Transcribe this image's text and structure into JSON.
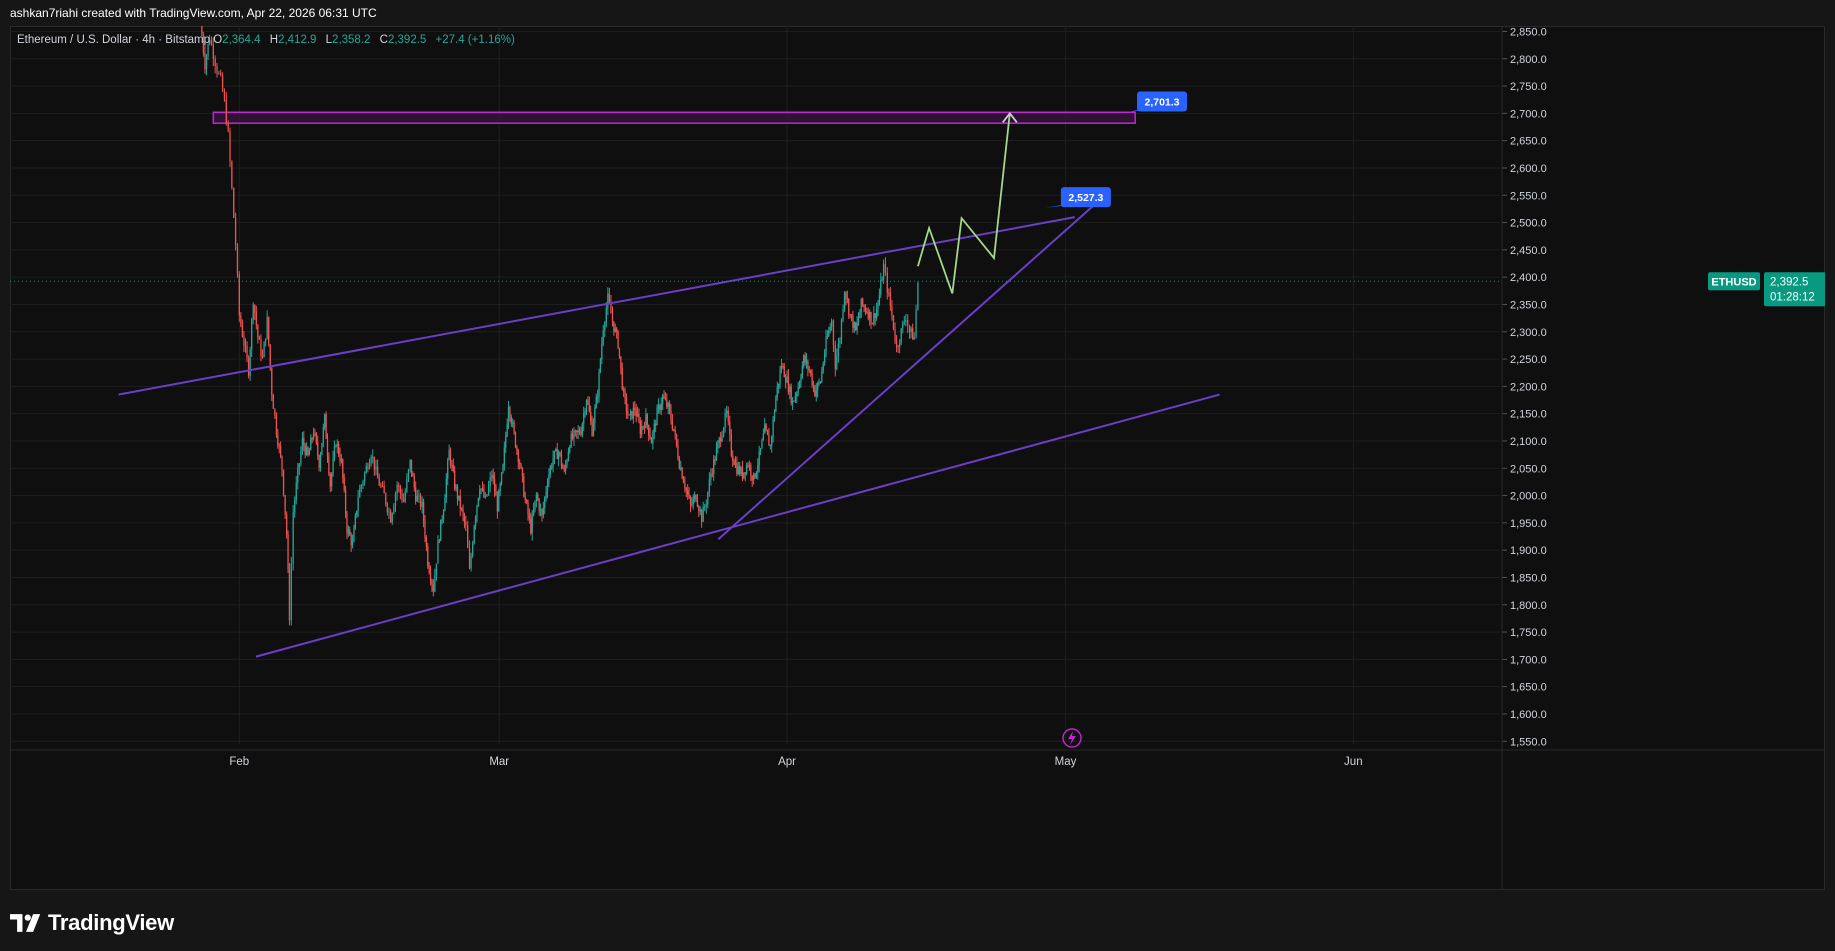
{
  "header": {
    "attribution": "ashkan7riahi created with TradingView.com, Apr 22, 2026 06:31 UTC"
  },
  "legend": {
    "name": "Ethereum / U.S. Dollar · 4h · Bitstamp",
    "o_label": "O",
    "o_value": "2,364.4",
    "h_label": "H",
    "h_value": "2,412.9",
    "l_label": "L",
    "l_value": "2,358.2",
    "c_label": "C",
    "c_value": "2,392.5",
    "change": "+27.4 (+1.16%)"
  },
  "footer": {
    "brand": "TradingView"
  },
  "colors": {
    "up": "#26a69a",
    "down": "#ef5350",
    "trendline": "#6a3fc8",
    "projection": "#a5d68a",
    "zone_border": "#c026d3",
    "zone_fill": "#3a1440",
    "callout": "#2962ff",
    "price_tag": "#089981"
  },
  "chart_data": {
    "type": "candlestick",
    "symbol": "ETHUSD",
    "timeframe": "4h",
    "y_axis": {
      "ticks": [
        "2,850.0",
        "2,800.0",
        "2,750.0",
        "2,700.0",
        "2,650.0",
        "2,600.0",
        "2,550.0",
        "2,500.0",
        "2,450.0",
        "2,400.0",
        "2,350.0",
        "2,300.0",
        "2,250.0",
        "2,200.0",
        "2,150.0",
        "2,100.0",
        "2,050.0",
        "2,000.0",
        "1,950.0",
        "1,900.0",
        "1,850.0",
        "1,800.0",
        "1,750.0",
        "1,700.0",
        "1,650.0",
        "1,600.0",
        "1,550.0"
      ],
      "ylim": [
        1545,
        2860
      ]
    },
    "x_axis": {
      "ticks": [
        {
          "label": "Feb",
          "day": 31
        },
        {
          "label": "Mar",
          "day": 59
        },
        {
          "label": "Apr",
          "day": 90
        },
        {
          "label": "May",
          "day": 120
        },
        {
          "label": "Jun",
          "day": 151
        }
      ],
      "xlim": [
        6.3,
        166.8
      ]
    },
    "last_price": {
      "symbol": "ETHUSD",
      "price": 2392.5,
      "label": "2,392.5",
      "countdown": "01:28:12"
    },
    "price_path": [
      [
        26.8,
        2870
      ],
      [
        27.3,
        2790
      ],
      [
        27.8,
        2840
      ],
      [
        28.2,
        2810
      ],
      [
        28.6,
        2780
      ],
      [
        29.0,
        2760
      ],
      [
        29.4,
        2720
      ],
      [
        29.8,
        2660
      ],
      [
        30.2,
        2560
      ],
      [
        30.6,
        2460
      ],
      [
        31.0,
        2330
      ],
      [
        31.5,
        2280
      ],
      [
        32.0,
        2230
      ],
      [
        32.5,
        2360
      ],
      [
        33.0,
        2290
      ],
      [
        33.5,
        2250
      ],
      [
        34.0,
        2320
      ],
      [
        34.5,
        2190
      ],
      [
        35.0,
        2120
      ],
      [
        35.6,
        2050
      ],
      [
        36.1,
        1930
      ],
      [
        36.4,
        1780
      ],
      [
        36.8,
        1970
      ],
      [
        37.3,
        2040
      ],
      [
        37.8,
        2100
      ],
      [
        38.4,
        2070
      ],
      [
        39.0,
        2120
      ],
      [
        39.6,
        2060
      ],
      [
        40.2,
        2140
      ],
      [
        40.8,
        2020
      ],
      [
        41.4,
        2100
      ],
      [
        42.0,
        2060
      ],
      [
        42.6,
        1940
      ],
      [
        43.2,
        1910
      ],
      [
        43.8,
        2000
      ],
      [
        44.5,
        2040
      ],
      [
        45.2,
        2080
      ],
      [
        45.9,
        2030
      ],
      [
        46.6,
        2000
      ],
      [
        47.3,
        1960
      ],
      [
        48.0,
        2020
      ],
      [
        48.7,
        1990
      ],
      [
        49.4,
        2060
      ],
      [
        50.0,
        2000
      ],
      [
        50.7,
        1980
      ],
      [
        51.3,
        1880
      ],
      [
        51.9,
        1830
      ],
      [
        52.4,
        1910
      ],
      [
        53.0,
        1980
      ],
      [
        53.6,
        2080
      ],
      [
        54.2,
        2020
      ],
      [
        54.8,
        1980
      ],
      [
        55.4,
        1940
      ],
      [
        55.8,
        1860
      ],
      [
        56.3,
        1950
      ],
      [
        56.9,
        2020
      ],
      [
        57.5,
        1990
      ],
      [
        58.2,
        2040
      ],
      [
        58.8,
        1980
      ],
      [
        59.4,
        2050
      ],
      [
        60.0,
        2170
      ],
      [
        60.6,
        2110
      ],
      [
        61.2,
        2060
      ],
      [
        61.8,
        1990
      ],
      [
        62.4,
        1940
      ],
      [
        63.0,
        2000
      ],
      [
        63.6,
        1960
      ],
      [
        64.2,
        2030
      ],
      [
        64.8,
        2070
      ],
      [
        65.4,
        2080
      ],
      [
        66.0,
        2040
      ],
      [
        66.6,
        2100
      ],
      [
        67.2,
        2110
      ],
      [
        67.8,
        2120
      ],
      [
        68.4,
        2180
      ],
      [
        69.0,
        2120
      ],
      [
        69.6,
        2190
      ],
      [
        70.2,
        2310
      ],
      [
        70.7,
        2360
      ],
      [
        71.2,
        2320
      ],
      [
        71.8,
        2280
      ],
      [
        72.4,
        2180
      ],
      [
        73.0,
        2140
      ],
      [
        73.6,
        2160
      ],
      [
        74.2,
        2120
      ],
      [
        74.8,
        2140
      ],
      [
        75.4,
        2100
      ],
      [
        76.0,
        2150
      ],
      [
        76.6,
        2180
      ],
      [
        77.2,
        2160
      ],
      [
        77.8,
        2120
      ],
      [
        78.4,
        2060
      ],
      [
        79.0,
        2020
      ],
      [
        79.6,
        1980
      ],
      [
        80.2,
        2000
      ],
      [
        80.8,
        1960
      ],
      [
        81.3,
        1990
      ],
      [
        81.8,
        2040
      ],
      [
        82.4,
        2080
      ],
      [
        83.0,
        2120
      ],
      [
        83.5,
        2150
      ],
      [
        84.0,
        2080
      ],
      [
        84.6,
        2050
      ],
      [
        85.2,
        2040
      ],
      [
        85.8,
        2060
      ],
      [
        86.4,
        2030
      ],
      [
        87.0,
        2070
      ],
      [
        87.6,
        2120
      ],
      [
        88.2,
        2090
      ],
      [
        88.8,
        2180
      ],
      [
        89.4,
        2240
      ],
      [
        90.0,
        2210
      ],
      [
        90.6,
        2170
      ],
      [
        91.2,
        2200
      ],
      [
        91.8,
        2250
      ],
      [
        92.4,
        2230
      ],
      [
        93.0,
        2190
      ],
      [
        93.6,
        2210
      ],
      [
        94.2,
        2280
      ],
      [
        94.8,
        2320
      ],
      [
        95.2,
        2240
      ],
      [
        95.7,
        2290
      ],
      [
        96.2,
        2380
      ],
      [
        96.8,
        2330
      ],
      [
        97.4,
        2300
      ],
      [
        98.0,
        2350
      ],
      [
        98.6,
        2340
      ],
      [
        99.2,
        2320
      ],
      [
        99.8,
        2350
      ],
      [
        100.4,
        2420
      ],
      [
        100.8,
        2380
      ],
      [
        101.3,
        2330
      ],
      [
        101.8,
        2270
      ],
      [
        102.3,
        2300
      ],
      [
        102.8,
        2330
      ],
      [
        103.2,
        2300
      ],
      [
        103.7,
        2290
      ],
      [
        104.1,
        2390
      ]
    ],
    "annotations": [
      {
        "type": "trendline",
        "name": "upper-channel",
        "from": [
          18.0,
          2185
        ],
        "to": [
          121.0,
          2510
        ]
      },
      {
        "type": "trendline",
        "name": "lower-channel",
        "from": [
          32.8,
          1705
        ],
        "to": [
          136.6,
          2185
        ]
      },
      {
        "type": "trendline",
        "name": "rising-support",
        "from": [
          82.6,
          1920
        ],
        "to": [
          123.6,
          2540
        ]
      },
      {
        "type": "zone",
        "name": "target-zone",
        "x_range": [
          28.2,
          127.5
        ],
        "y_range": [
          2682,
          2702
        ]
      },
      {
        "type": "projection",
        "name": "projected-path",
        "points": [
          [
            104.1,
            2420
          ],
          [
            105.3,
            2490
          ],
          [
            107.8,
            2370
          ],
          [
            108.8,
            2508
          ],
          [
            112.3,
            2435
          ],
          [
            114.0,
            2700
          ]
        ]
      },
      {
        "type": "callout",
        "label": "2,701.3",
        "value": 2701.3,
        "anchor": [
          126.7,
          2702
        ],
        "box": [
          127.7,
          2740
        ]
      },
      {
        "type": "callout",
        "label": "2,527.3",
        "value": 2527.3,
        "anchor": [
          117.8,
          2527
        ],
        "box": [
          119.5,
          2565
        ]
      }
    ]
  }
}
